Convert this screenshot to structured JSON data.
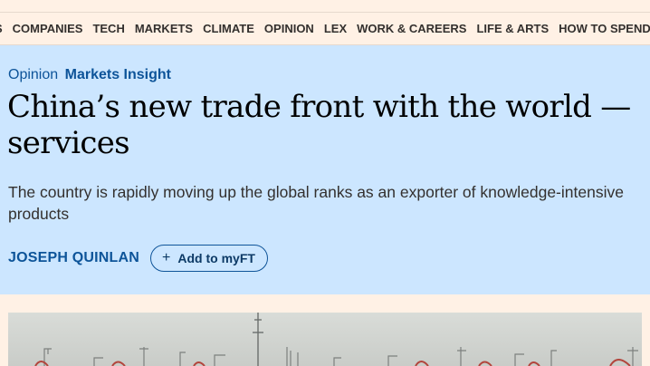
{
  "nav": {
    "items": [
      "S",
      "COMPANIES",
      "TECH",
      "MARKETS",
      "CLIMATE",
      "OPINION",
      "LEX",
      "WORK & CAREERS",
      "LIFE & ARTS",
      "HOW TO SPEND IT"
    ]
  },
  "article": {
    "genre": "Opinion",
    "series": "Markets Insight",
    "headline": "China’s new trade front with the world — services",
    "standfirst": "The country is rapidly moving up the global ranks as an exporter of knowledge-intensive products",
    "author": "JOSEPH QUINLAN",
    "myft_label": "Add to myFT",
    "myft_icon": "plus-icon"
  },
  "image": {
    "subject": "port-cranes-photo"
  },
  "colors": {
    "page_bg": "#fff1e5",
    "hero_bg": "#cce6ff",
    "link_blue": "#0d5499"
  }
}
